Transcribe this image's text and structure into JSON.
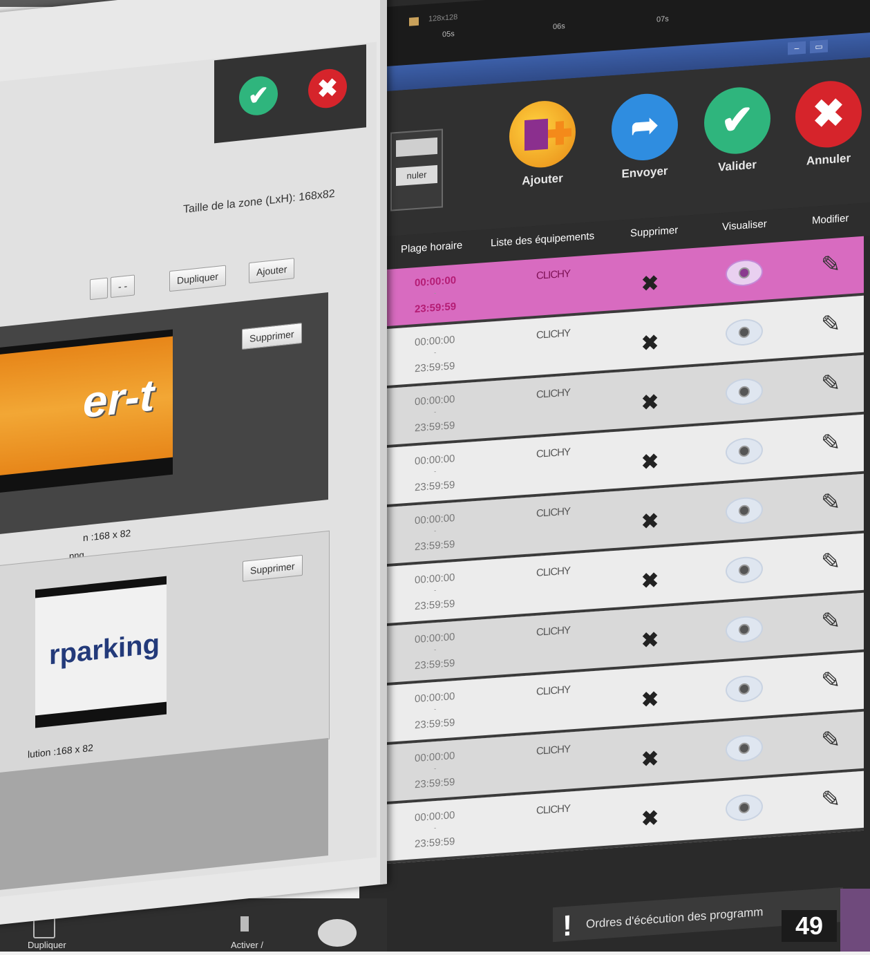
{
  "timeline": {
    "resolution": "128x128",
    "markers": [
      "05s",
      "06s",
      "07s"
    ]
  },
  "toolbar": {
    "combo_button": "nuler",
    "add_label": "Ajouter",
    "send_label": "Envoyer",
    "validate_label": "Valider",
    "cancel_label": "Annuler"
  },
  "table": {
    "headers": [
      "Plage horaire",
      "Liste des équipements",
      "Supprimer",
      "Visualiser",
      "Modifier"
    ],
    "rows": [
      {
        "start": "00:00:00",
        "end": "23:59:59",
        "equipment": "CLICHY",
        "selected": true
      },
      {
        "start": "00:00:00",
        "end": "23:59:59",
        "equipment": "CLICHY"
      },
      {
        "start": "00:00:00",
        "end": "23:59:59",
        "equipment": "CLICHY"
      },
      {
        "start": "00:00:00",
        "end": "23:59:59",
        "equipment": "CLICHY"
      },
      {
        "start": "00:00:00",
        "end": "23:59:59",
        "equipment": "CLICHY"
      },
      {
        "start": "00:00:00",
        "end": "23:59:59",
        "equipment": "CLICHY"
      },
      {
        "start": "00:00:00",
        "end": "23:59:59",
        "equipment": "CLICHY"
      },
      {
        "start": "00:00:00",
        "end": "23:59:59",
        "equipment": "CLICHY"
      },
      {
        "start": "00:00:00",
        "end": "23:59:59",
        "equipment": "CLICHY"
      },
      {
        "start": "00:00:00",
        "end": "23:59:59",
        "equipment": "CLICHY"
      }
    ]
  },
  "status": {
    "message": "Ordres d'écécution des programm"
  },
  "taskbar": {
    "duplicate_label": "Dupliquer",
    "activate_label": "Activer /"
  },
  "dialog": {
    "zone_size_label": "Taille de la zone (LxH): 168x82",
    "nav_button": "- -",
    "duplicate_button": "Dupliquer",
    "add_button": "Ajouter",
    "delete_button_1": "Supprimer",
    "delete_button_2": "Supprimer",
    "image1_text": "er-t",
    "image1_resolution": "n :168 x 82",
    "image1_format": "png",
    "image2_text": "rparking",
    "image2_resolution": "lution :168 x 82"
  },
  "page_number": "49",
  "colors": {
    "accept": "#2fb57d",
    "reject": "#d6242b",
    "send": "#2f8de0",
    "selected_row": "#d86bc0"
  }
}
